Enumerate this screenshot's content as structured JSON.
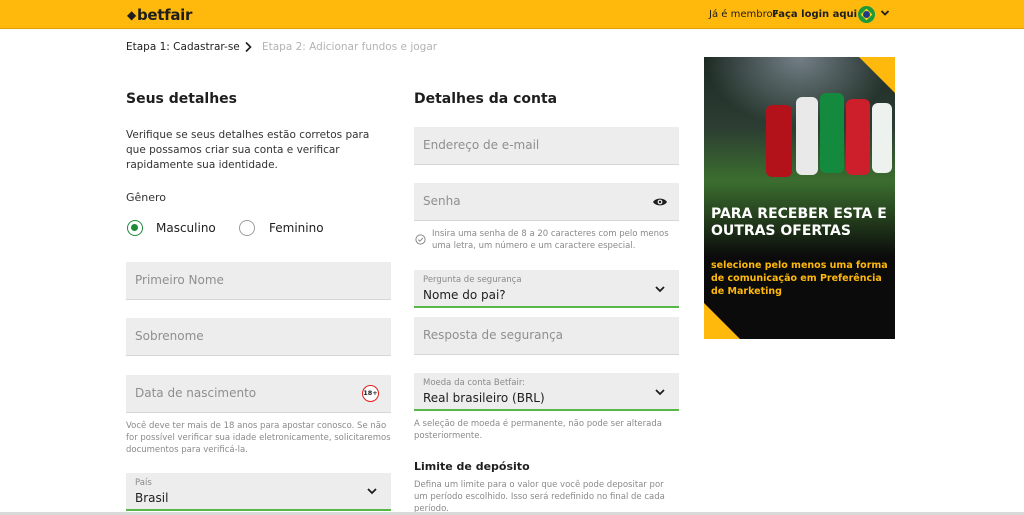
{
  "header": {
    "brand": "betfair",
    "member_question": "Já é membro?",
    "login_link": "Faça login aqui",
    "flag_icon": "brazil-flag-icon",
    "brand_color": "#ffb80c"
  },
  "steps": {
    "step1": "Etapa 1: Cadastrar-se",
    "step2": "Etapa 2: Adicionar fundos e jogar"
  },
  "personal": {
    "title": "Seus detalhes",
    "intro": "Verifique se seus detalhes estão corretos para que possamos criar sua conta e verificar rapidamente sua identidade.",
    "gender_label": "Gênero",
    "gender_options": [
      "Masculino",
      "Feminino"
    ],
    "gender_selected": "Masculino",
    "first_name_placeholder": "Primeiro Nome",
    "last_name_placeholder": "Sobrenome",
    "dob_placeholder": "Data de nascimento",
    "age_badge": "18+",
    "age_note": "Você deve ter mais de 18 anos para apostar conosco. Se não for possível verificar sua idade eletronicamente, solicitaremos documentos para verificá-la.",
    "country_label": "País",
    "country_value": "Brasil"
  },
  "account": {
    "title": "Detalhes da conta",
    "email_placeholder": "Endereço de e-mail",
    "password_placeholder": "Senha",
    "password_hint": "Insira uma senha de 8 a 20 caracteres com pelo menos uma letra, um número e um caractere especial.",
    "security_question_label": "Pergunta de segurança",
    "security_question_value": "Nome do pai?",
    "security_answer_placeholder": "Resposta de segurança",
    "currency_label": "Moeda da conta Betfair:",
    "currency_value": "Real brasileiro (BRL)",
    "currency_note": "A seleção de moeda é permanente, não pode ser alterada posteriormente.",
    "deposit_title": "Limite de depósito",
    "deposit_text": "Defina um limite para o valor que você pode depositar por um período escolhido. Isso será redefinido no final de cada período."
  },
  "promo": {
    "title": "PARA RECEBER ESTA E OUTRAS OFERTAS",
    "subtitle": "selecione pelo menos uma forma de comunicação em Preferência de Marketing"
  }
}
